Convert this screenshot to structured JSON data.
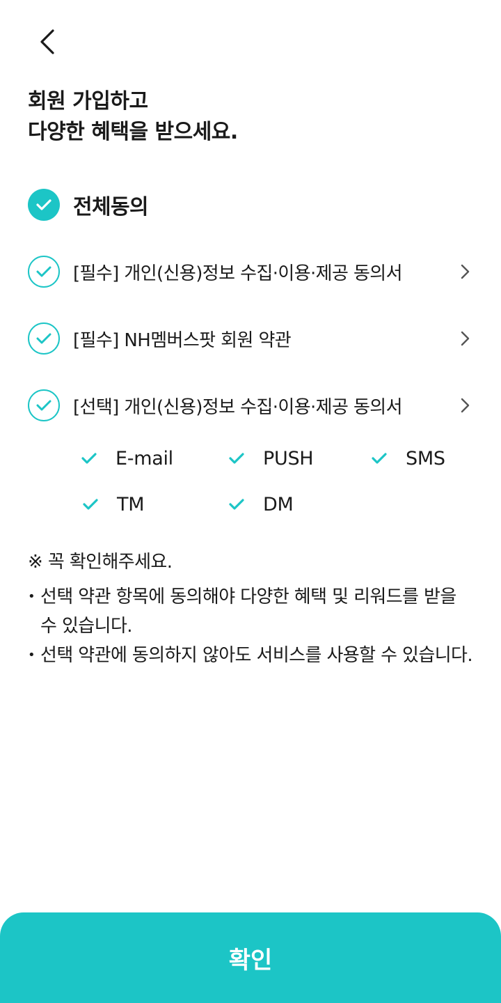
{
  "header": {
    "back_icon": "chevron-left-icon"
  },
  "title": {
    "line1": "회원 가입하고",
    "line2": "다양한 혜택을 받으세요."
  },
  "agreements": {
    "all_label": "전체동의",
    "items": [
      {
        "label": "[필수] 개인(신용)정보 수집·이용·제공 동의서",
        "checked": true
      },
      {
        "label": "[필수] NH멤버스팟 회원 약관",
        "checked": true
      },
      {
        "label": "[선택] 개인(신용)정보 수집·이용·제공 동의서",
        "checked": true
      }
    ]
  },
  "channels": [
    {
      "label": "E-mail",
      "checked": true
    },
    {
      "label": "PUSH",
      "checked": true
    },
    {
      "label": "SMS",
      "checked": true
    },
    {
      "label": "TM",
      "checked": true
    },
    {
      "label": "DM",
      "checked": true
    }
  ],
  "notice": {
    "heading": "※ 꼭 확인해주세요.",
    "bullets": [
      "선택 약관 항목에 동의해야 다양한 혜택 및 리워드를 받을 수 있습니다.",
      "선택 약관에 동의하지 않아도 서비스를 사용할 수 있습니다."
    ]
  },
  "confirm_label": "확인",
  "colors": {
    "accent": "#1cc5c6",
    "text": "#1a1a1a",
    "chevron": "#555555"
  }
}
